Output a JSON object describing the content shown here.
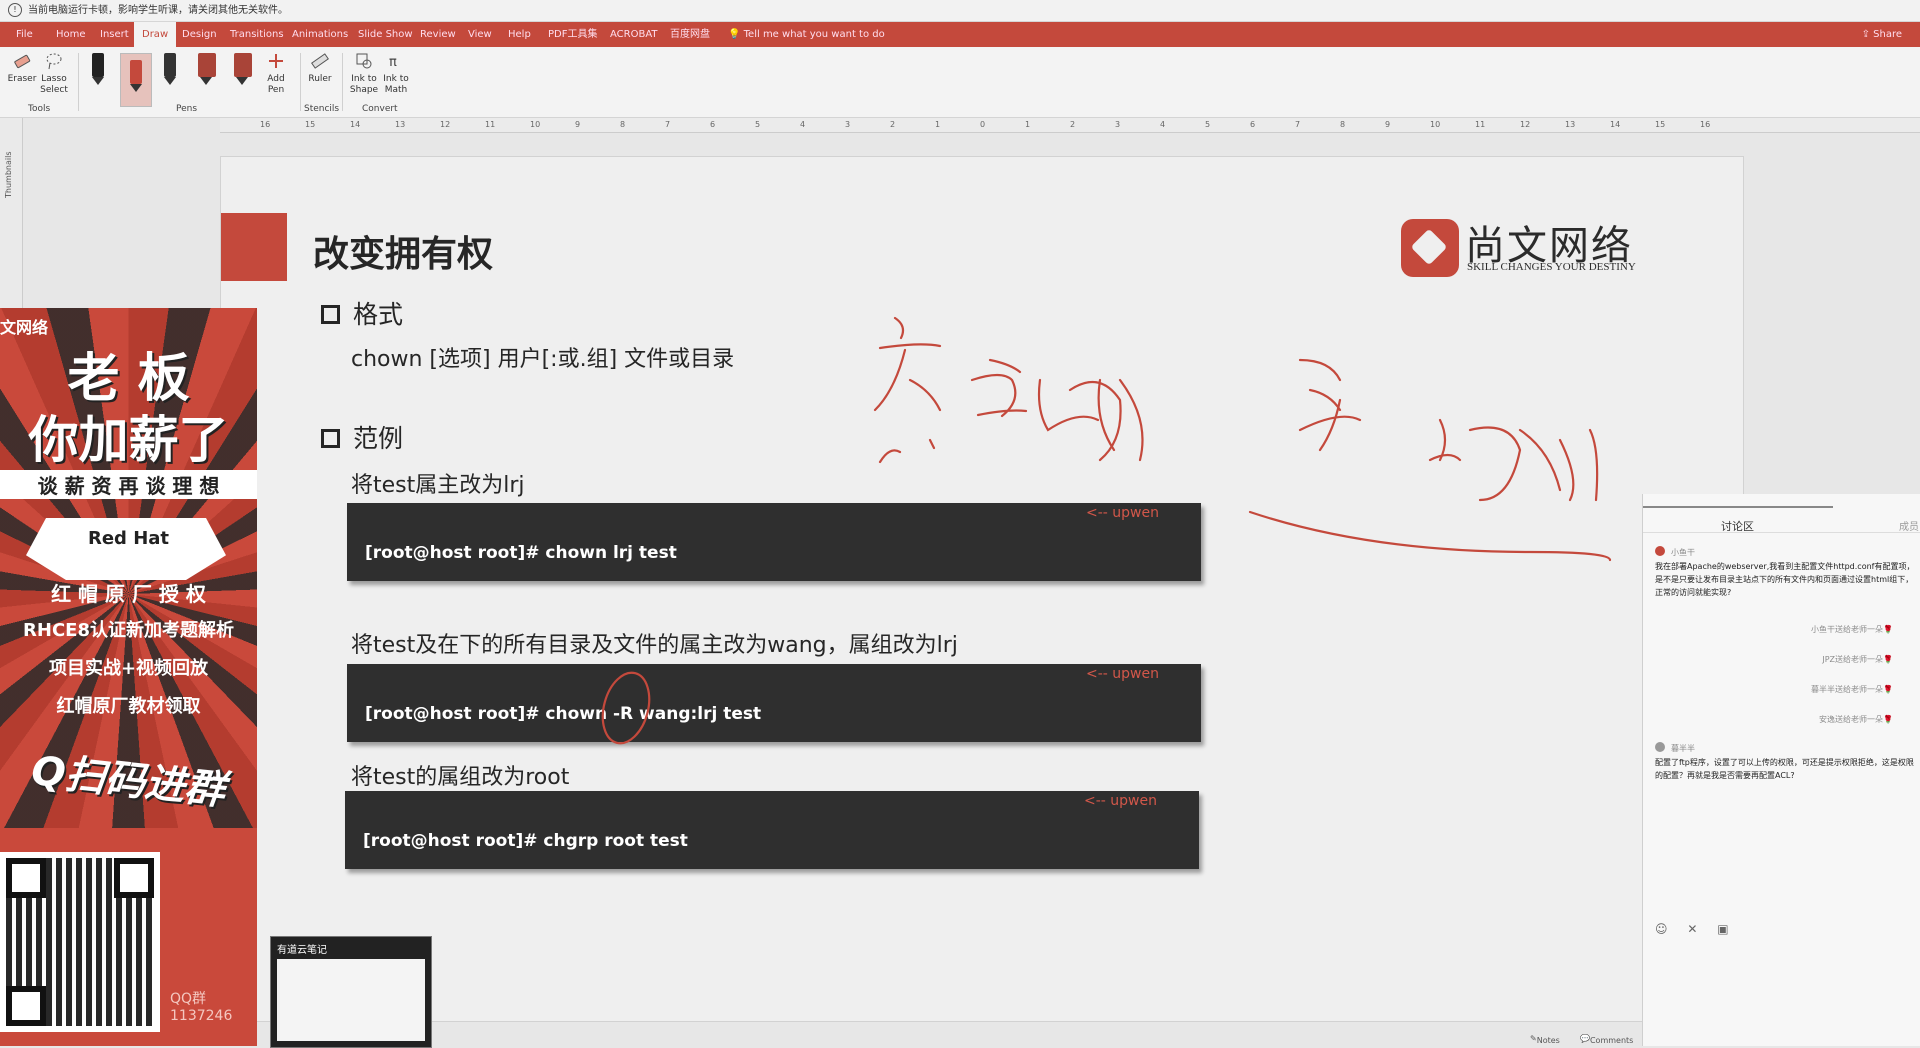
{
  "warning": {
    "text": "当前电脑运行卡顿，影响学生听课，请关闭其他无关软件。"
  },
  "ribbon": {
    "tabs": [
      "File",
      "Home",
      "Insert",
      "Draw",
      "Design",
      "Transitions",
      "Animations",
      "Slide Show",
      "Review",
      "View",
      "Help",
      "PDF工具集",
      "ACROBAT",
      "百度网盘"
    ],
    "active_tab": "Draw",
    "tell_me": "Tell me what you want to do",
    "share": "Share"
  },
  "toolbar": {
    "eraser": "Eraser",
    "lasso": "Lasso Select",
    "add_pen": "Add Pen",
    "ruler": "Ruler",
    "ink_to_shape": "Ink to Shape",
    "ink_to_math": "Ink to Math",
    "group_tools": "Tools",
    "group_pens": "Pens",
    "group_stencils": "Stencils",
    "group_convert": "Convert"
  },
  "ruler_ticks": [
    "16",
    "15",
    "14",
    "13",
    "12",
    "11",
    "10",
    "9",
    "8",
    "7",
    "6",
    "5",
    "4",
    "3",
    "2",
    "1",
    "0",
    "1",
    "2",
    "3",
    "4",
    "5",
    "6",
    "7",
    "8",
    "9",
    "10",
    "11",
    "12",
    "13",
    "14",
    "15",
    "16"
  ],
  "thumbnails_label": "Thumbnails",
  "slide": {
    "title": "改变拥有权",
    "logo_name": "尚文网络",
    "logo_sub": "SKILL CHANGES YOUR DESTINY",
    "section1": "格式",
    "syntax": "chown [选项] 用户[:或.组] 文件或目录",
    "section2": "范例",
    "ex1_desc": "将test属主改为lrj",
    "ex1_cmd": "[root@host root]# chown lrj  test",
    "ex2_desc": "将test及在下的所有目录及文件的属主改为wang，属组改为lrj",
    "ex2_cmd": "[root@host root]# chown  -R wang:lrj test",
    "ex3_desc": "将test的属组改为root",
    "ex3_cmd": "[root@host root]# chgrp  root test",
    "tag": "<-- upwen"
  },
  "promo": {
    "brand": "文网络",
    "line1": "老  板",
    "line2": "你加薪了",
    "line3": "谈 薪 资 再 谈 理 想",
    "redhat": "Red Hat",
    "line4": "红 帽 原 厂 授 权",
    "line5": "RHCE8认证新加考题解析",
    "line6": "项目实战+视频回放",
    "line7": "红帽原厂教材领取",
    "line8": "Q扫码进群",
    "qq": "QQ群",
    "qq_no": "1137246"
  },
  "youdao": {
    "title": "有道云笔记"
  },
  "chat": {
    "title": "讨论区",
    "more": "成员",
    "user1": "小鱼干",
    "msg1": "我在部署Apache的webserver,我看到主配置文件httpd.conf有配置项，是不是只要让发布目录主站点下的所有文件内和页面通过设置html组下，正常的访问就能实现?",
    "sys1": "小鱼干送给老师一朵🌹",
    "sys2": "JPZ送给老师一朵🌹",
    "sys3": "暮半半送给老师一朵🌹",
    "sys4": "安逸送给老师一朵🌹",
    "user2": "暮半半",
    "msg2": "配置了ftp程序，设置了可以上传的权限，可还是提示权限拒绝，这是权限的配置？再就是我是否需要再配置ACL?",
    "footer_icons": "☺ ✕ ▣"
  },
  "status": {
    "notes": "Notes",
    "comments": "Comments"
  }
}
